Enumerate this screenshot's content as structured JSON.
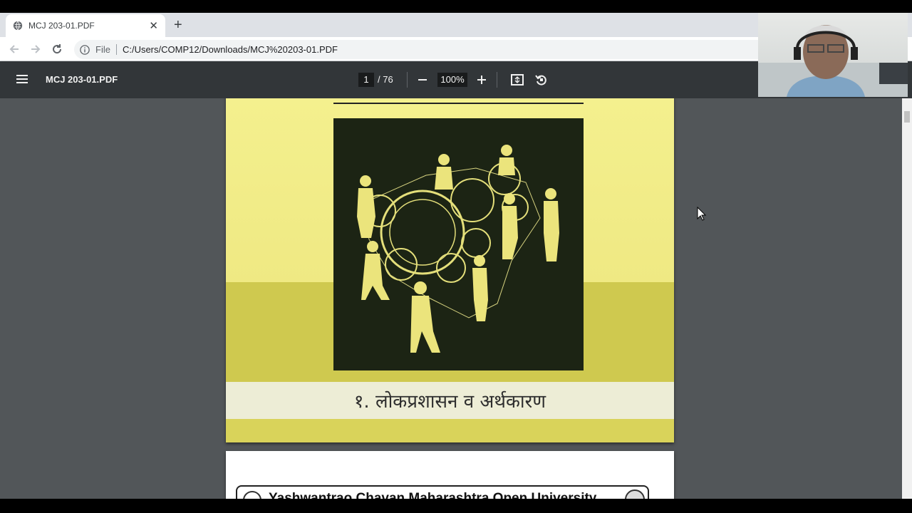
{
  "browser": {
    "tab_title": "MCJ 203-01.PDF",
    "new_tab": "+",
    "close_tab": "✕",
    "address_scheme_label": "File",
    "address_url": "C:/Users/COMP12/Downloads/MCJ%20203-01.PDF"
  },
  "pdf_toolbar": {
    "title": "MCJ 203-01.PDF",
    "current_page": "1",
    "total_pages": "/ 76",
    "zoom": "100%"
  },
  "document": {
    "cover_title": "१. लोकप्रशासन व अर्थकारण",
    "page2_heading": "Yashwantrao Chavan Maharashtra Open University"
  },
  "colors": {
    "toolbar_bg": "#323639",
    "viewer_bg": "#525659",
    "cover_yellow": "#f3ef8c",
    "art_bg": "#1c2414"
  }
}
